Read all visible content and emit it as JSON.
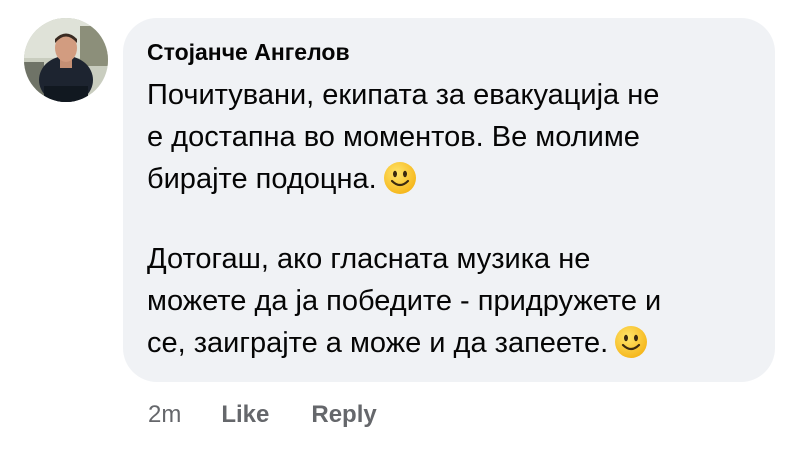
{
  "comment": {
    "author": "Стојанче Ангелов",
    "paragraph1": [
      "Почитувани, екипата за евакуација не",
      "е достапна во моментов. Ве молиме",
      "бирајте подоцна."
    ],
    "paragraph2": [
      "Дотогаш, ако гласната музика не",
      "можете да ја победите - придружете и",
      "се, заиграјте а може и да запеете."
    ],
    "emoji": "slightly-smiling-face"
  },
  "actions": {
    "time": "2m",
    "like_label": "Like",
    "reply_label": "Reply"
  },
  "colors": {
    "bubble": "#f0f2f5",
    "text": "#050505",
    "meta": "#65676b"
  }
}
